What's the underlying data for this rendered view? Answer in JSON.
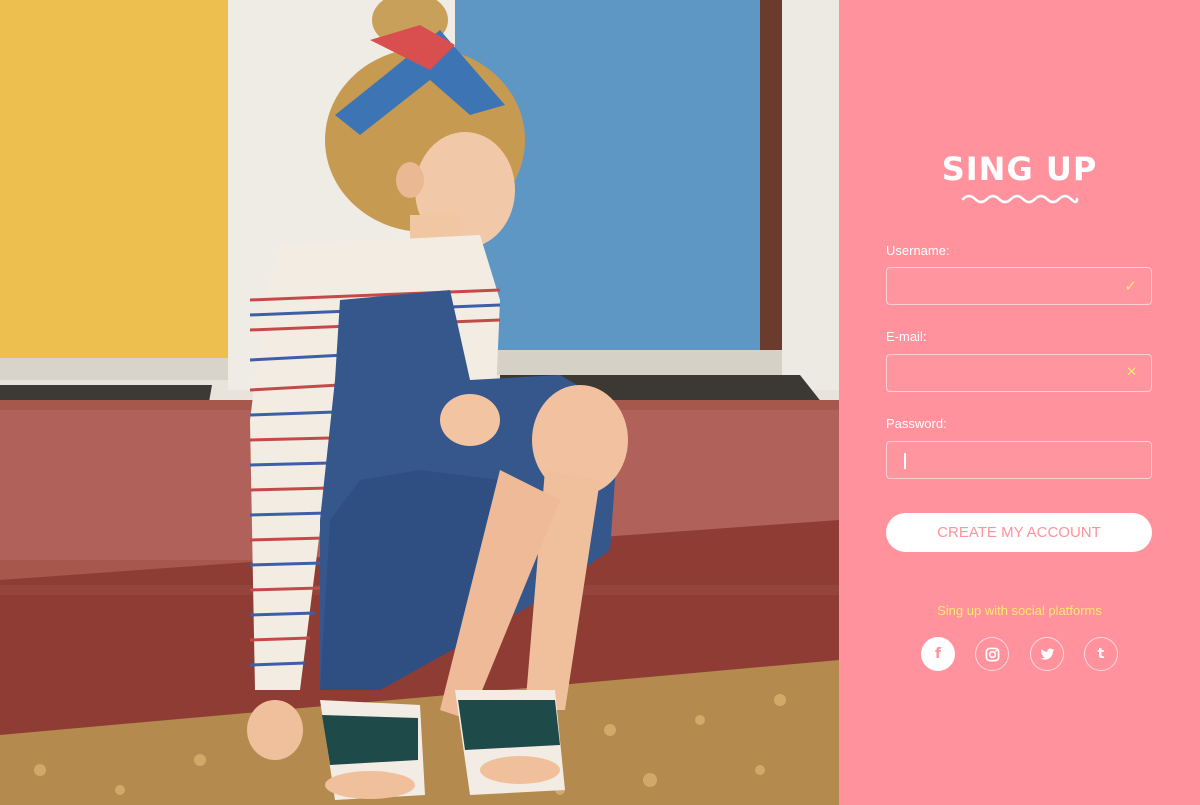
{
  "colors": {
    "panel": "#ff929c",
    "accent_yellow": "#ffe970",
    "white": "#ffffff"
  },
  "photo": {
    "subject": "girl-on-step-photo"
  },
  "form": {
    "title": "SING UP",
    "username": {
      "label": "Username:",
      "value": "",
      "status_icon": "check-icon",
      "status_glyph": "✓"
    },
    "email": {
      "label": "E-mail:",
      "value": "",
      "status_icon": "cross-icon",
      "status_glyph": "✕"
    },
    "password": {
      "label": "Password:",
      "value": ""
    },
    "submit_label": "CREATE MY ACCOUNT"
  },
  "social": {
    "text": "Sing up with social platforms",
    "platforms": [
      {
        "name": "facebook",
        "glyph": "f"
      },
      {
        "name": "instagram",
        "glyph": ""
      },
      {
        "name": "twitter",
        "glyph": ""
      },
      {
        "name": "tumblr",
        "glyph": "t"
      }
    ]
  }
}
